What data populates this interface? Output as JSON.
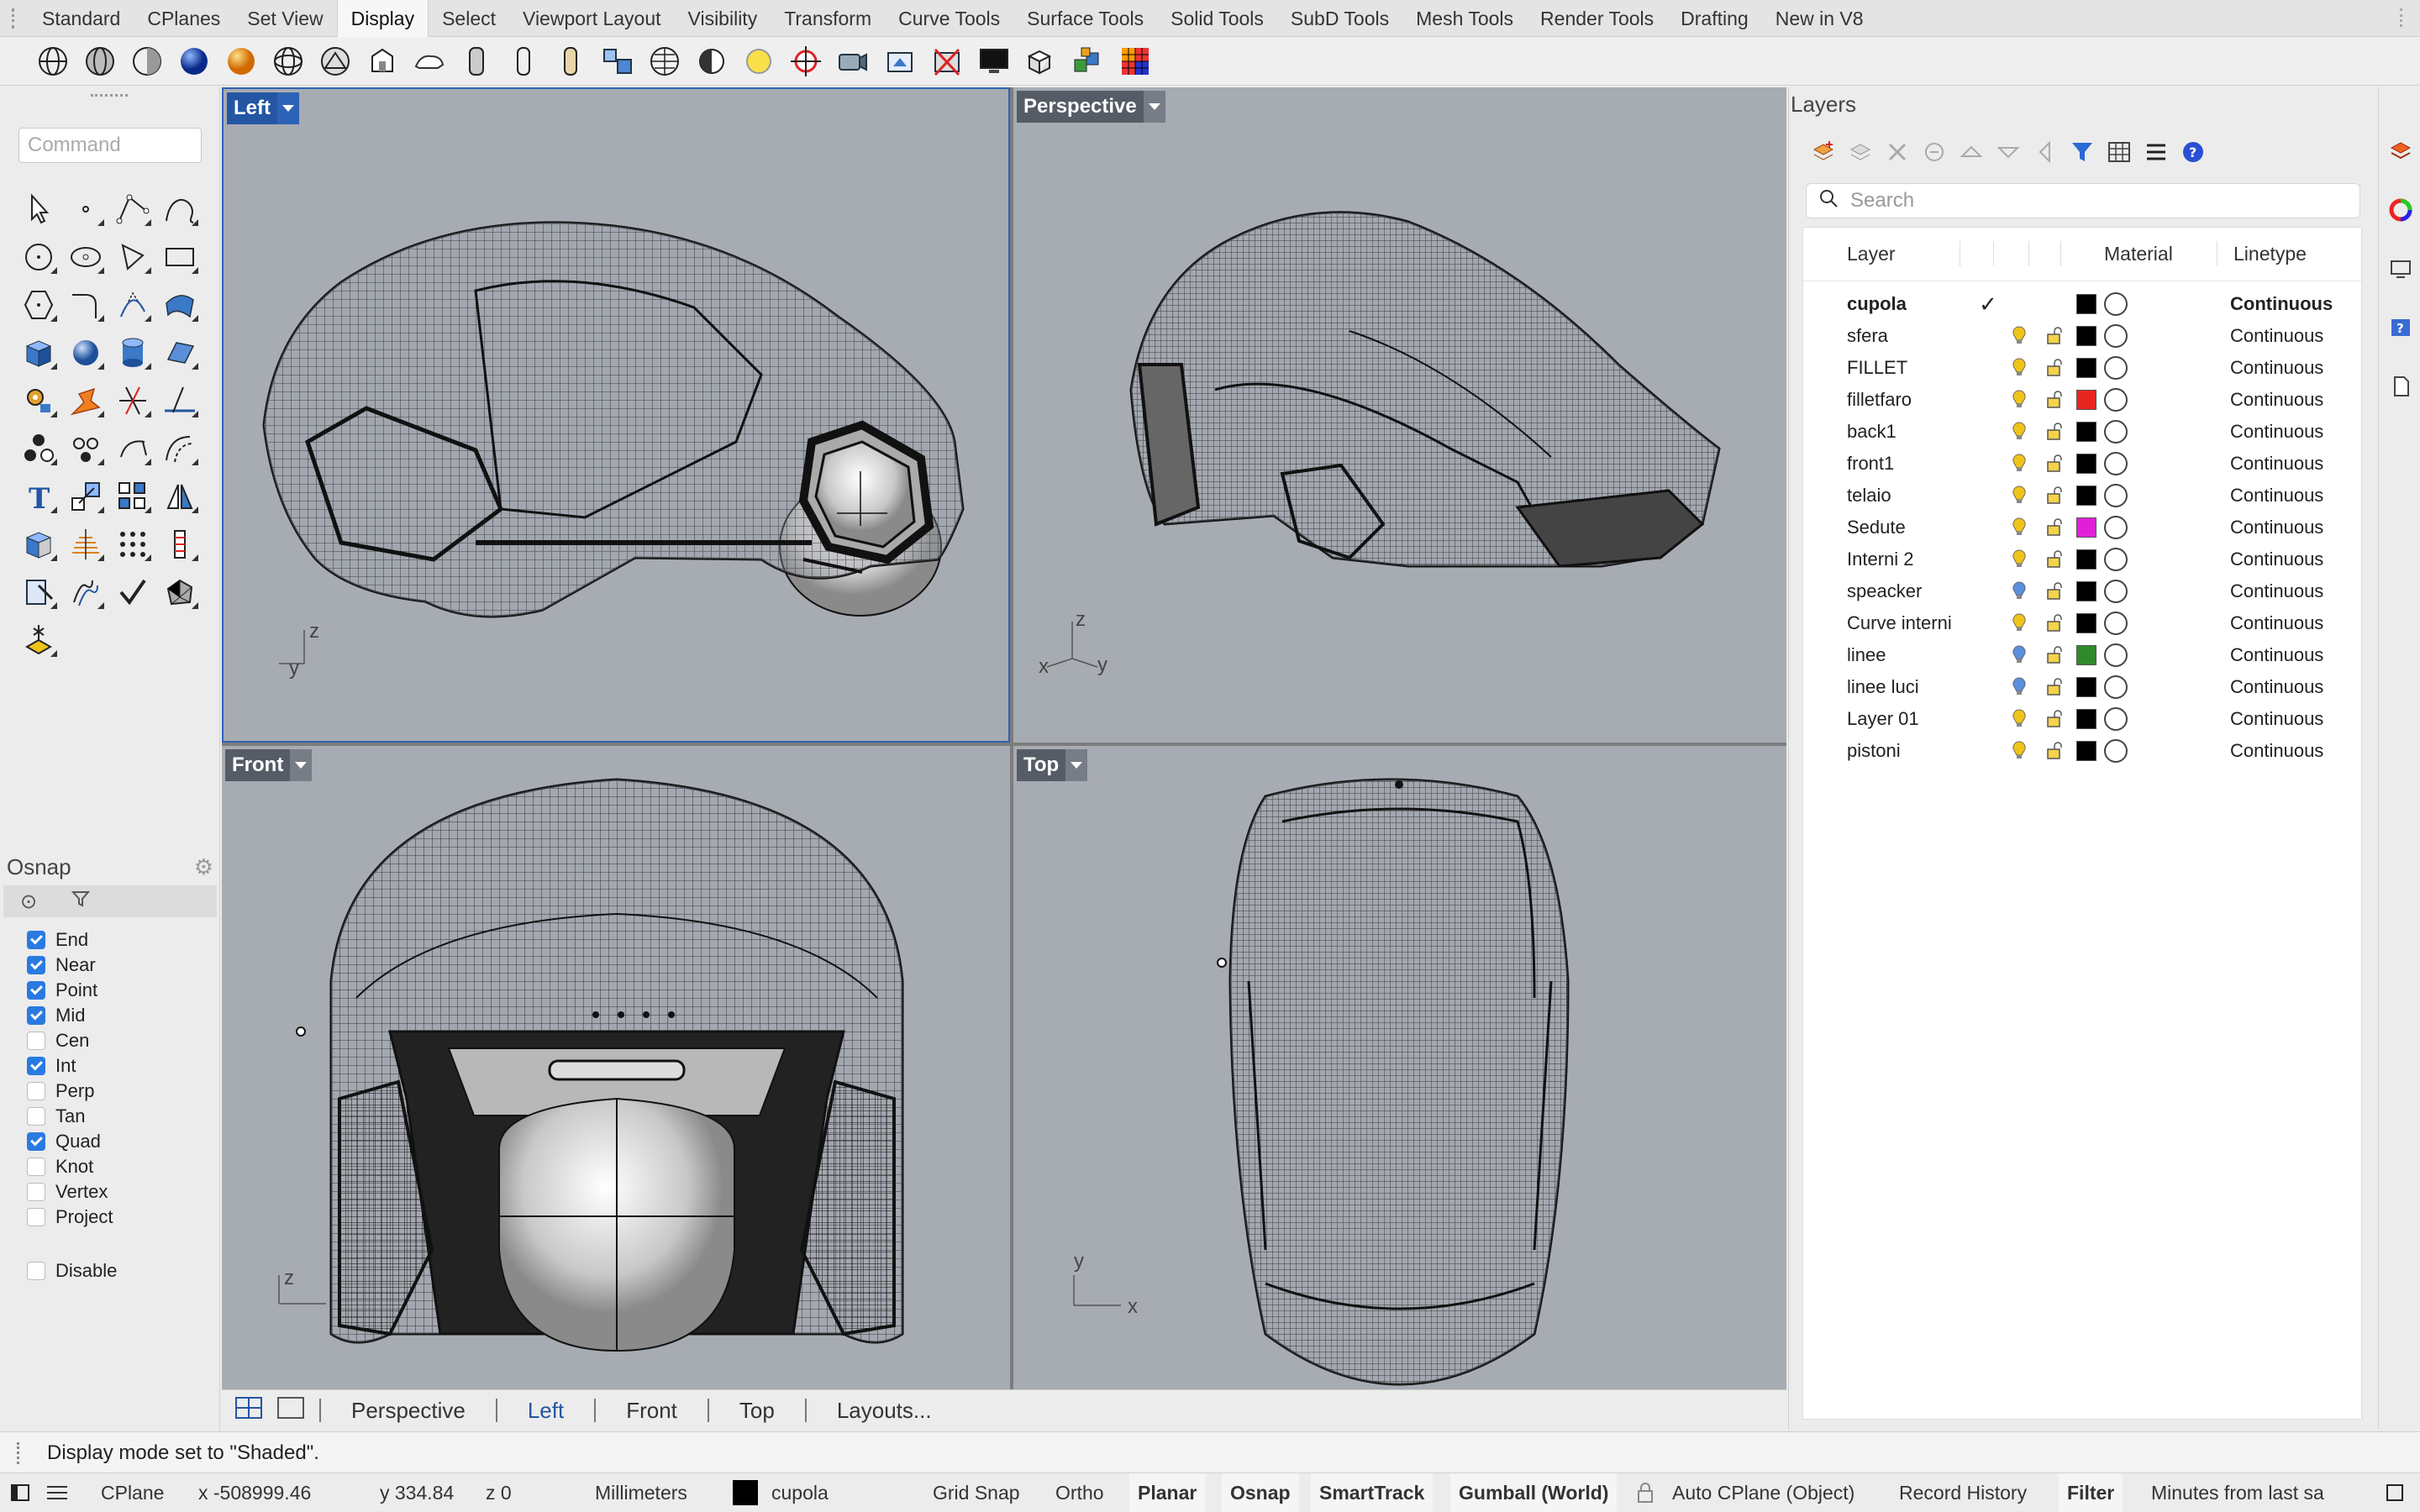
{
  "menu_tabs": [
    "Standard",
    "CPlanes",
    "Set View",
    "Display",
    "Select",
    "Viewport Layout",
    "Visibility",
    "Transform",
    "Curve Tools",
    "Surface Tools",
    "Solid Tools",
    "SubD Tools",
    "Mesh Tools",
    "Render Tools",
    "Drafting",
    "New in V8"
  ],
  "active_menu_tab": "Display",
  "command": {
    "placeholder": "Command"
  },
  "osnap": {
    "title": "Osnap",
    "items": [
      {
        "label": "End",
        "checked": true
      },
      {
        "label": "Near",
        "checked": true
      },
      {
        "label": "Point",
        "checked": true
      },
      {
        "label": "Mid",
        "checked": true
      },
      {
        "label": "Cen",
        "checked": false
      },
      {
        "label": "Int",
        "checked": true
      },
      {
        "label": "Perp",
        "checked": false
      },
      {
        "label": "Tan",
        "checked": false
      },
      {
        "label": "Quad",
        "checked": true
      },
      {
        "label": "Knot",
        "checked": false
      },
      {
        "label": "Vertex",
        "checked": false
      },
      {
        "label": "Project",
        "checked": false
      }
    ],
    "disable": {
      "label": "Disable",
      "checked": false
    }
  },
  "viewports": {
    "left": {
      "name": "Left",
      "axis_h": "y",
      "axis_v": "z"
    },
    "perspective": {
      "name": "Perspective",
      "axis_x": "x",
      "axis_y": "y",
      "axis_z": "z"
    },
    "front": {
      "name": "Front",
      "axis_v": "z"
    },
    "top": {
      "name": "Top",
      "axis_h": "x",
      "axis_v": "y"
    }
  },
  "viewport_tabs": {
    "items": [
      "Perspective",
      "Left",
      "Front",
      "Top",
      "Layouts..."
    ],
    "active": "Left"
  },
  "layers": {
    "title": "Layers",
    "search_placeholder": "Search",
    "columns": {
      "layer": "Layer",
      "material": "Material",
      "linetype": "Linetype"
    },
    "current_mark": "✓",
    "rows": [
      {
        "name": "cupola",
        "current": true,
        "bulb": "#f0c419",
        "color": "#000000",
        "linetype": "Continuous"
      },
      {
        "name": "sfera",
        "current": false,
        "bulb": "#f0c419",
        "color": "#000000",
        "linetype": "Continuous"
      },
      {
        "name": "FILLET",
        "current": false,
        "bulb": "#f0c419",
        "color": "#000000",
        "linetype": "Continuous"
      },
      {
        "name": "filletfaro",
        "current": false,
        "bulb": "#f0c419",
        "color": "#e8261f",
        "linetype": "Continuous"
      },
      {
        "name": "back1",
        "current": false,
        "bulb": "#f0c419",
        "color": "#000000",
        "linetype": "Continuous"
      },
      {
        "name": "front1",
        "current": false,
        "bulb": "#f0c419",
        "color": "#000000",
        "linetype": "Continuous"
      },
      {
        "name": "telaio",
        "current": false,
        "bulb": "#f0c419",
        "color": "#000000",
        "linetype": "Continuous"
      },
      {
        "name": "Sedute",
        "current": false,
        "bulb": "#f0c419",
        "color": "#e020d8",
        "linetype": "Continuous"
      },
      {
        "name": "Interni 2",
        "current": false,
        "bulb": "#f0c419",
        "color": "#000000",
        "linetype": "Continuous"
      },
      {
        "name": "speacker",
        "current": false,
        "bulb": "#5b8fe0",
        "color": "#000000",
        "linetype": "Continuous"
      },
      {
        "name": "Curve interni",
        "current": false,
        "bulb": "#f0c419",
        "color": "#000000",
        "linetype": "Continuous"
      },
      {
        "name": "linee",
        "current": false,
        "bulb": "#5b8fe0",
        "color": "#2e8a2a",
        "linetype": "Continuous"
      },
      {
        "name": "linee luci",
        "current": false,
        "bulb": "#5b8fe0",
        "color": "#000000",
        "linetype": "Continuous"
      },
      {
        "name": "Layer 01",
        "current": false,
        "bulb": "#f0c419",
        "color": "#000000",
        "linetype": "Continuous"
      },
      {
        "name": "pistoni",
        "current": false,
        "bulb": "#f0c419",
        "color": "#000000",
        "linetype": "Continuous"
      }
    ]
  },
  "command_history": "Display mode set to \"Shaded\".",
  "status": {
    "cplane": "CPlane",
    "x": "x -508999.46",
    "y": "y 334.84",
    "z": "z 0",
    "units": "Millimeters",
    "layer": "cupola",
    "grid_snap": "Grid Snap",
    "ortho": "Ortho",
    "planar": "Planar",
    "osnap": "Osnap",
    "smarttrack": "SmartTrack",
    "gumball": "Gumball (World)",
    "auto_cplane": "Auto CPlane (Object)",
    "record_history": "Record History",
    "filter": "Filter",
    "minutes": "Minutes from last sa"
  }
}
